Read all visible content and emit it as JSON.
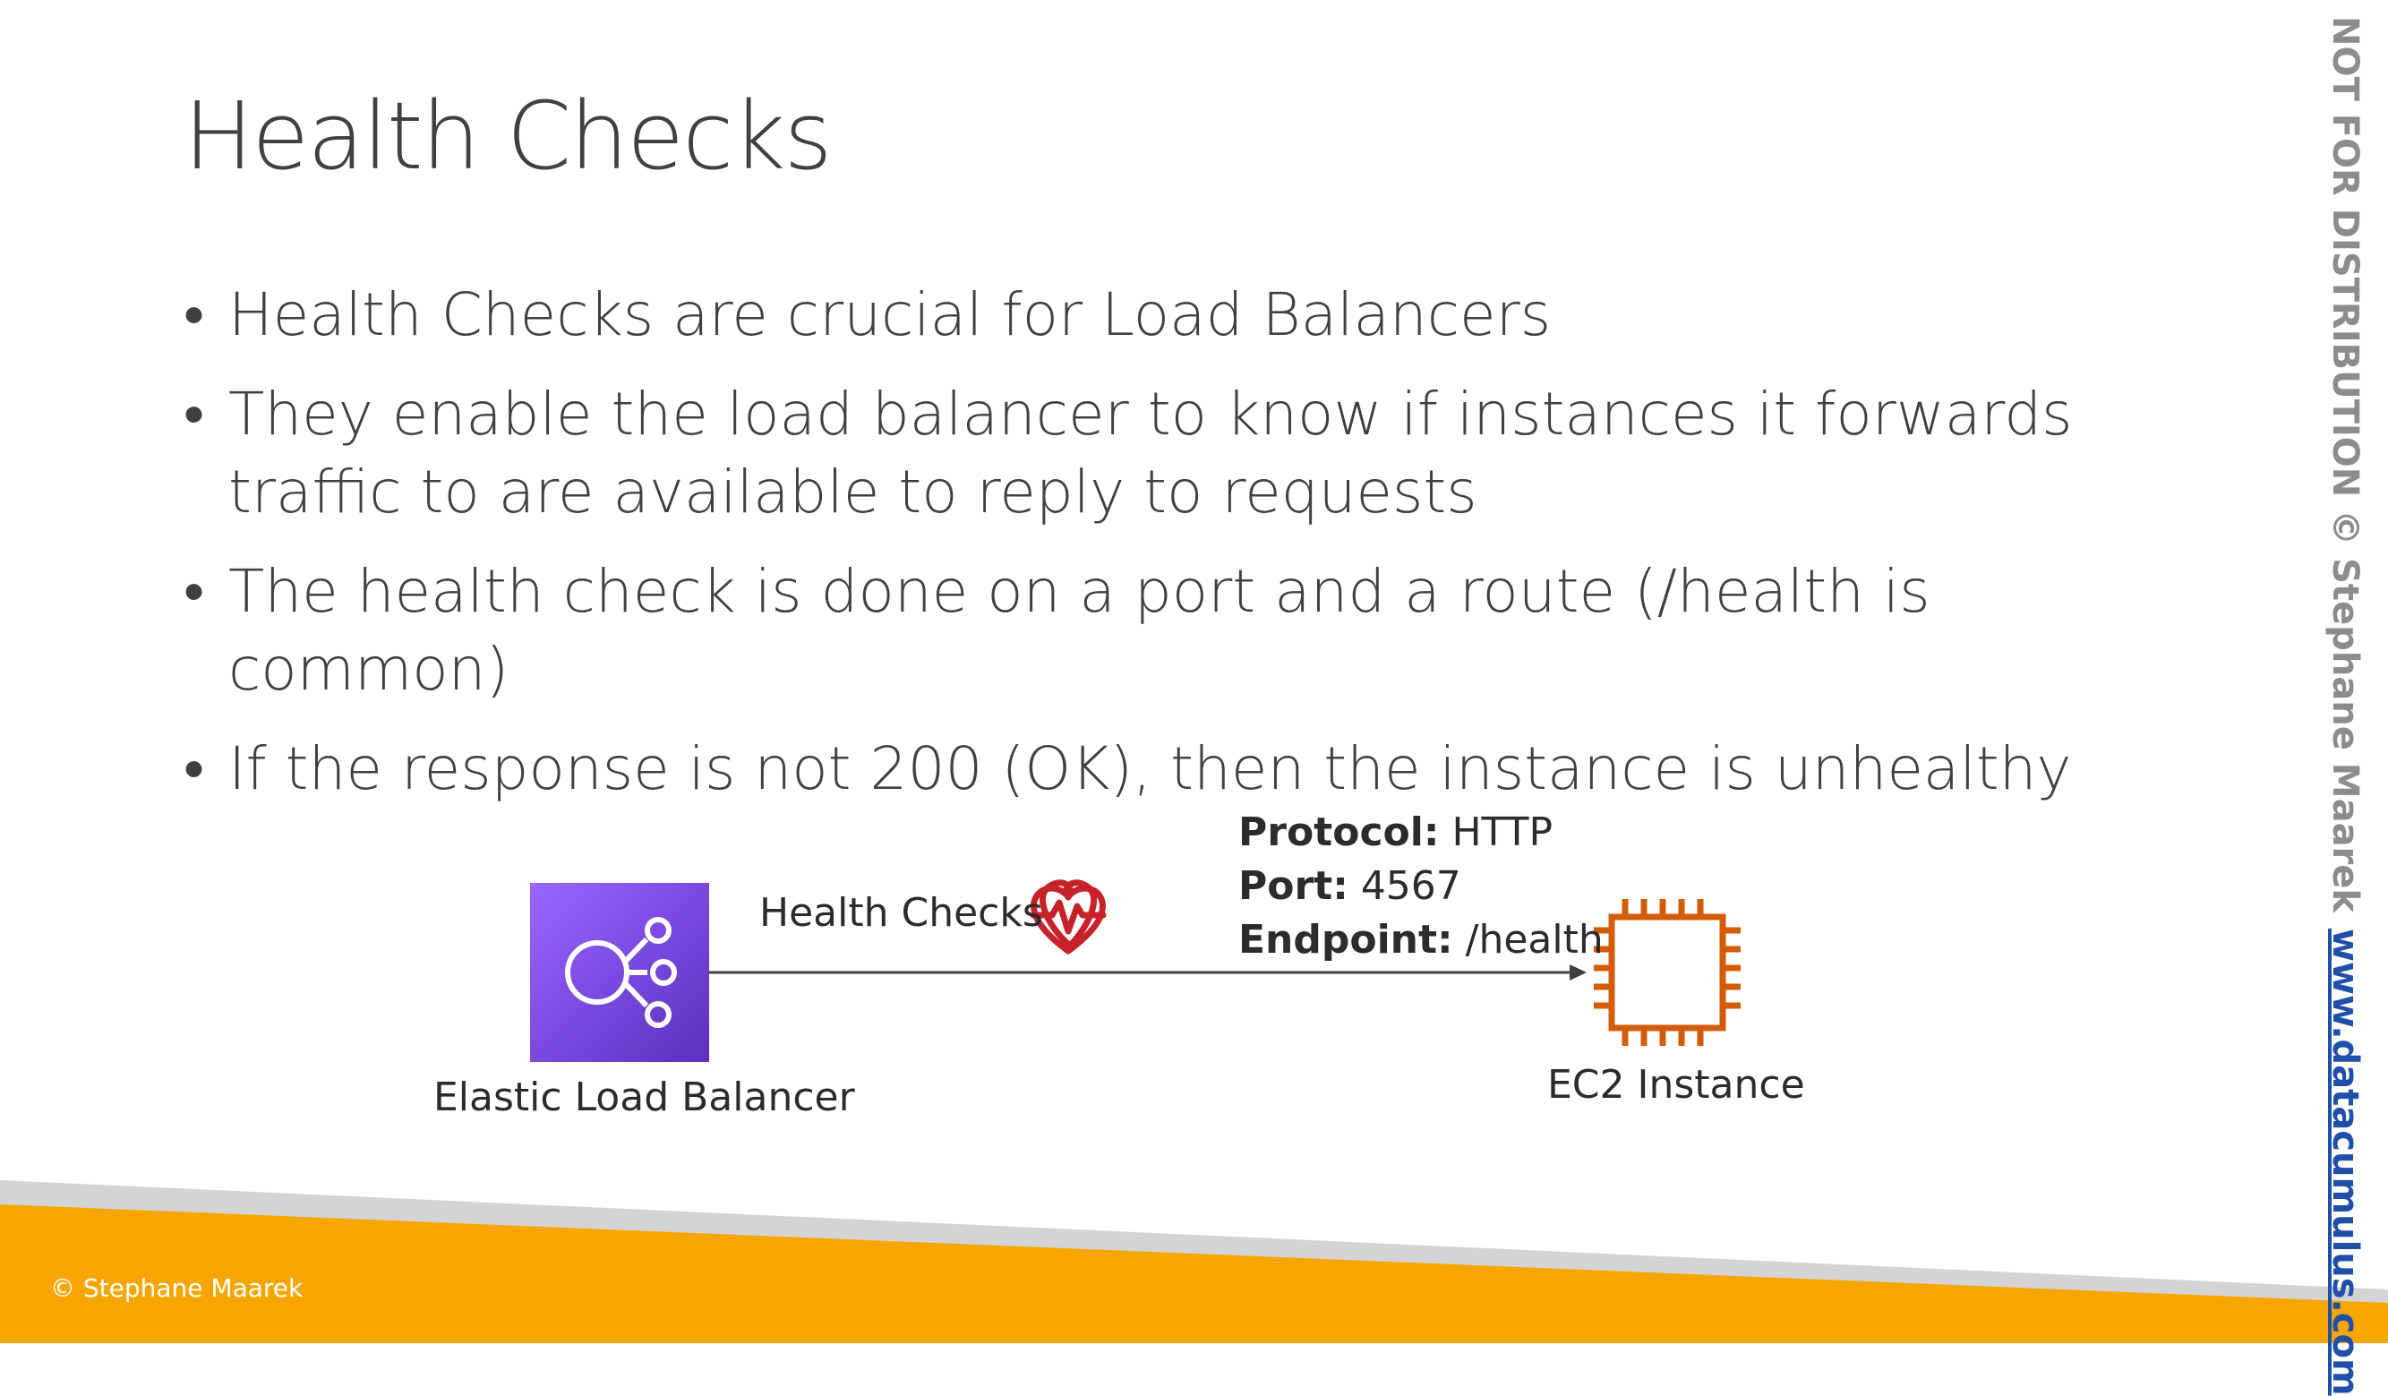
{
  "slide": {
    "title": "Health Checks",
    "bullets": [
      "Health Checks are crucial for Load Balancers",
      "They enable the load balancer to know if instances it forwards traffic to are available to reply to requests",
      "The health check is done on a port and a route (/health is common)",
      "If the response is not 200 (OK), then the instance is unhealthy"
    ]
  },
  "diagram": {
    "elb_label": "Elastic Load Balancer",
    "arrow_label": "Health Checks",
    "ec2_label": "EC2 Instance",
    "protocol_key": "Protocol:",
    "protocol_value": "HTTP",
    "port_key": "Port:",
    "port_value": "4567",
    "endpoint_key": "Endpoint:",
    "endpoint_value": "/health",
    "icons": [
      "load-balancer-icon",
      "heart-pulse-icon",
      "ec2-chip-icon"
    ],
    "colors": {
      "elb_top": "#9a66ff",
      "elb_bottom": "#5a2fc1",
      "heart": "#c7222a",
      "ec2": "#d45b07"
    }
  },
  "footer": {
    "copyright": "© Stephane Maarek",
    "colors": {
      "orange": "#f7a600",
      "gray": "#d4d4d4"
    }
  },
  "sidebar": {
    "notice": "NOT FOR DISTRIBUTION © Stephane Maarek",
    "link": "www.datacumulus.com"
  }
}
